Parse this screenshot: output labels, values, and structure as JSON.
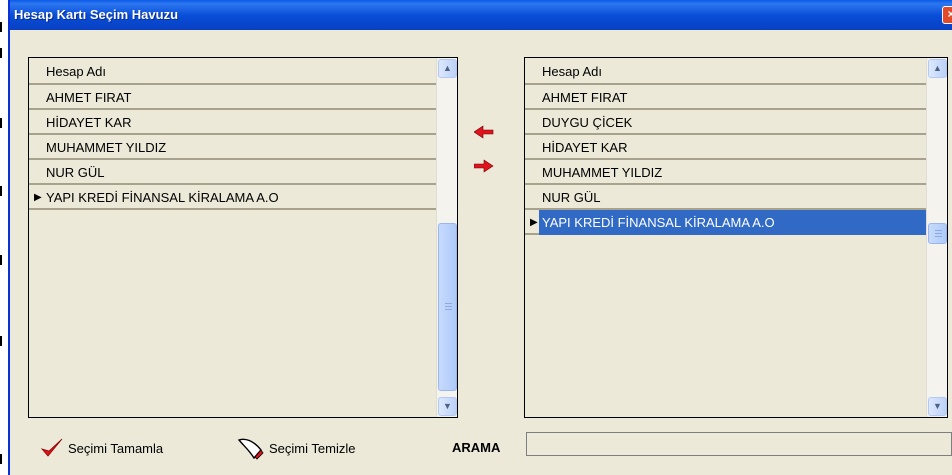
{
  "window": {
    "title": "Hesap Kartı Seçim Havuzu",
    "close_symbol": "×"
  },
  "left_grid": {
    "header": "Hesap Adı",
    "rows": [
      "AHMET FIRAT",
      "HİDAYET KAR",
      "MUHAMMET YILDIZ",
      "NUR GÜL",
      "YAPI KREDİ FİNANSAL KİRALAMA A.O"
    ],
    "current_row_index": 4,
    "scroll_position": 0.5
  },
  "right_grid": {
    "header": "Hesap Adı",
    "rows": [
      "AHMET FIRAT",
      "DUYGU ÇİCEK",
      "HİDAYET KAR",
      "MUHAMMET YILDIZ",
      "NUR GÜL",
      "YAPI KREDİ FİNANSAL KİRALAMA A.O"
    ],
    "current_row_index": 5,
    "selected_row_index": 5
  },
  "footer": {
    "complete_label": "Seçimi Tamamla",
    "clear_label": "Seçimi Temizle",
    "search_label": "ARAMA",
    "search_value": ""
  },
  "colors": {
    "titlebar": "#0a4fd8",
    "selection": "#316ac5",
    "arrow": "#e0141e",
    "dialog_bg": "#ece9d8"
  }
}
